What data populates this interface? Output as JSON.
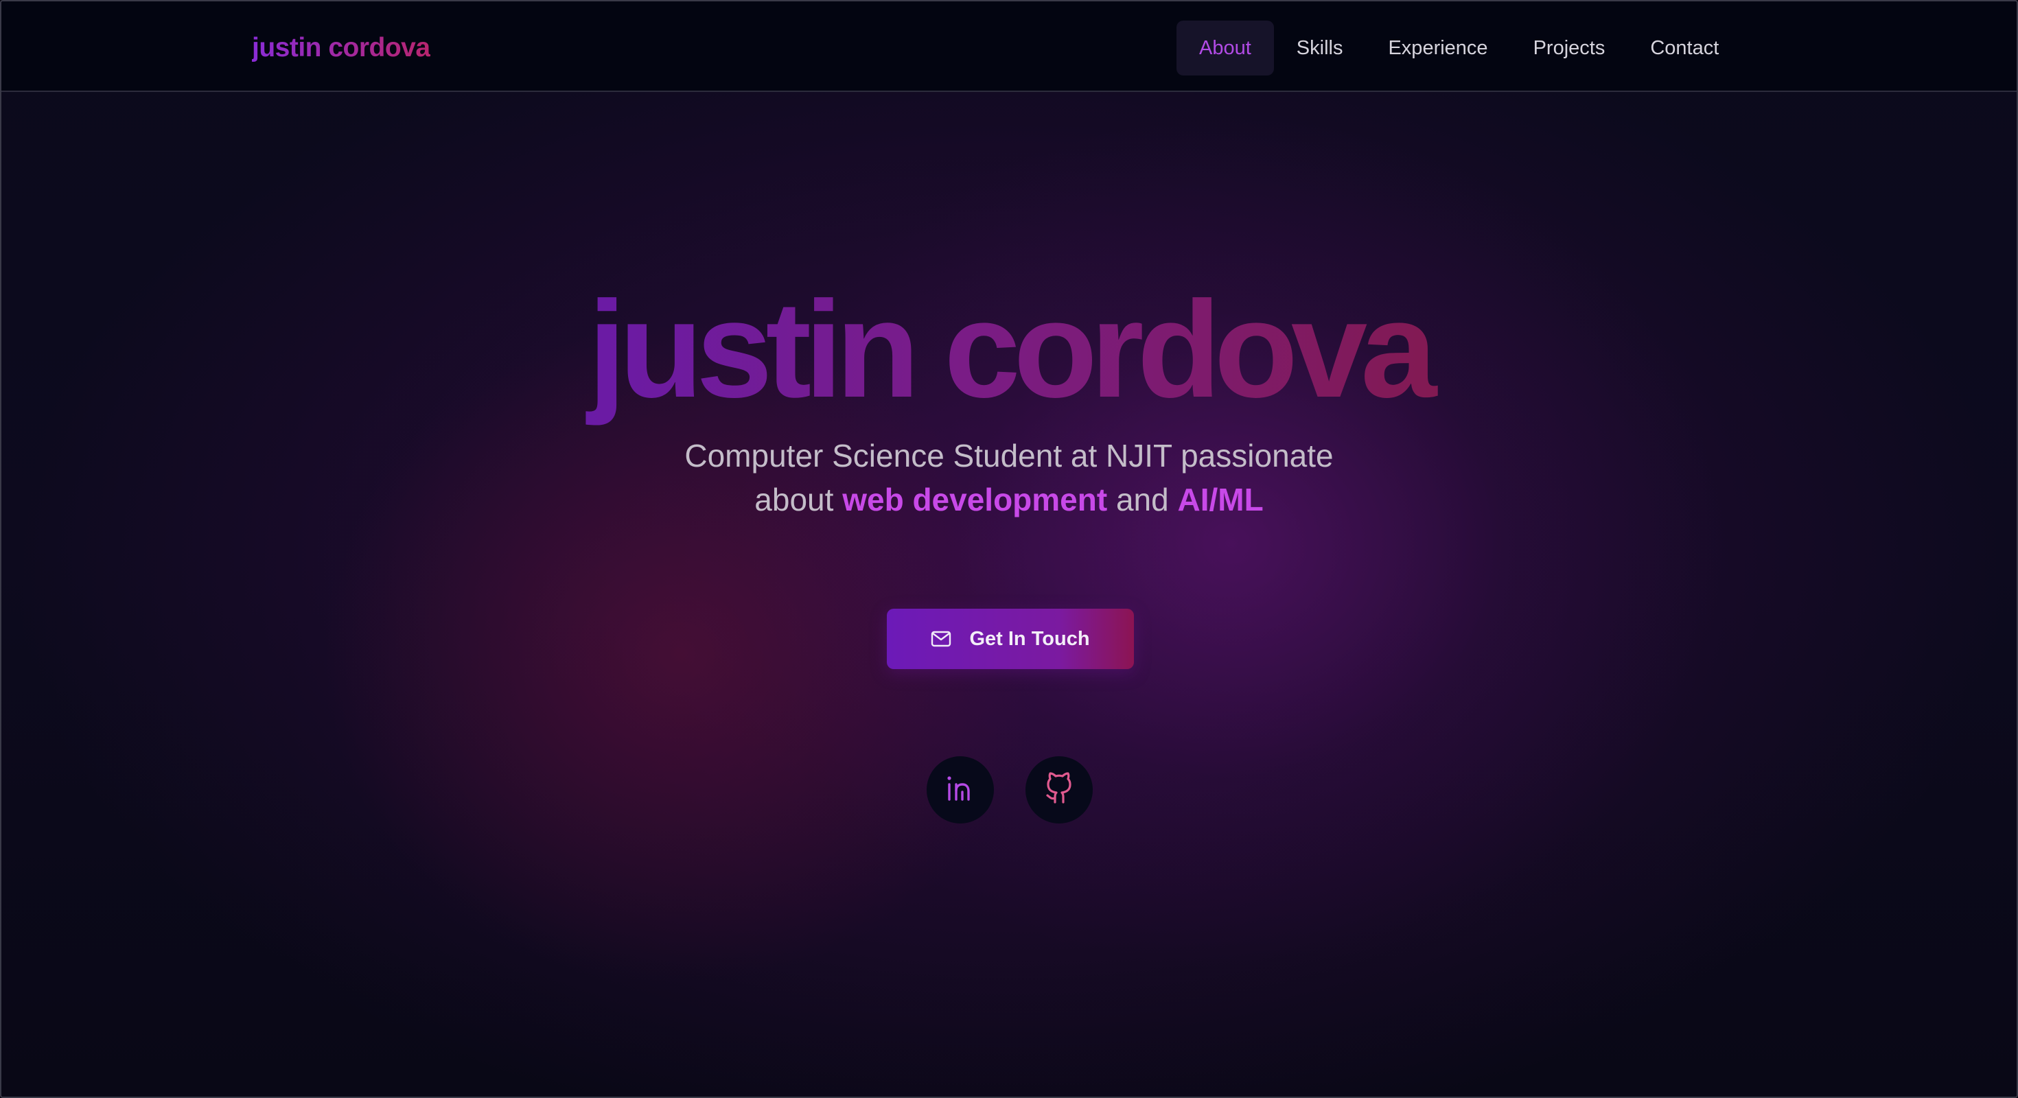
{
  "nav": {
    "brand": "justin cordova",
    "links": [
      {
        "label": "About",
        "active": true
      },
      {
        "label": "Skills",
        "active": false
      },
      {
        "label": "Experience",
        "active": false
      },
      {
        "label": "Projects",
        "active": false
      },
      {
        "label": "Contact",
        "active": false
      }
    ]
  },
  "hero": {
    "title": "justin cordova",
    "subtitle_line1": "Computer Science Student at NJIT passionate",
    "subtitle_about": "about ",
    "subtitle_highlight1": "web development",
    "subtitle_and": " and ",
    "subtitle_highlight2": "AI/ML",
    "cta_label": "Get In Touch",
    "cta_icon": "mail-icon"
  },
  "social": [
    {
      "name": "linkedin",
      "icon": "linkedin-icon",
      "color": "#b54ae6"
    },
    {
      "name": "github",
      "icon": "github-icon",
      "color": "#e05a8f"
    }
  ],
  "colors": {
    "accent_purple": "#b24be6",
    "highlight": "#c849e8",
    "nav_bg": "#030511"
  }
}
